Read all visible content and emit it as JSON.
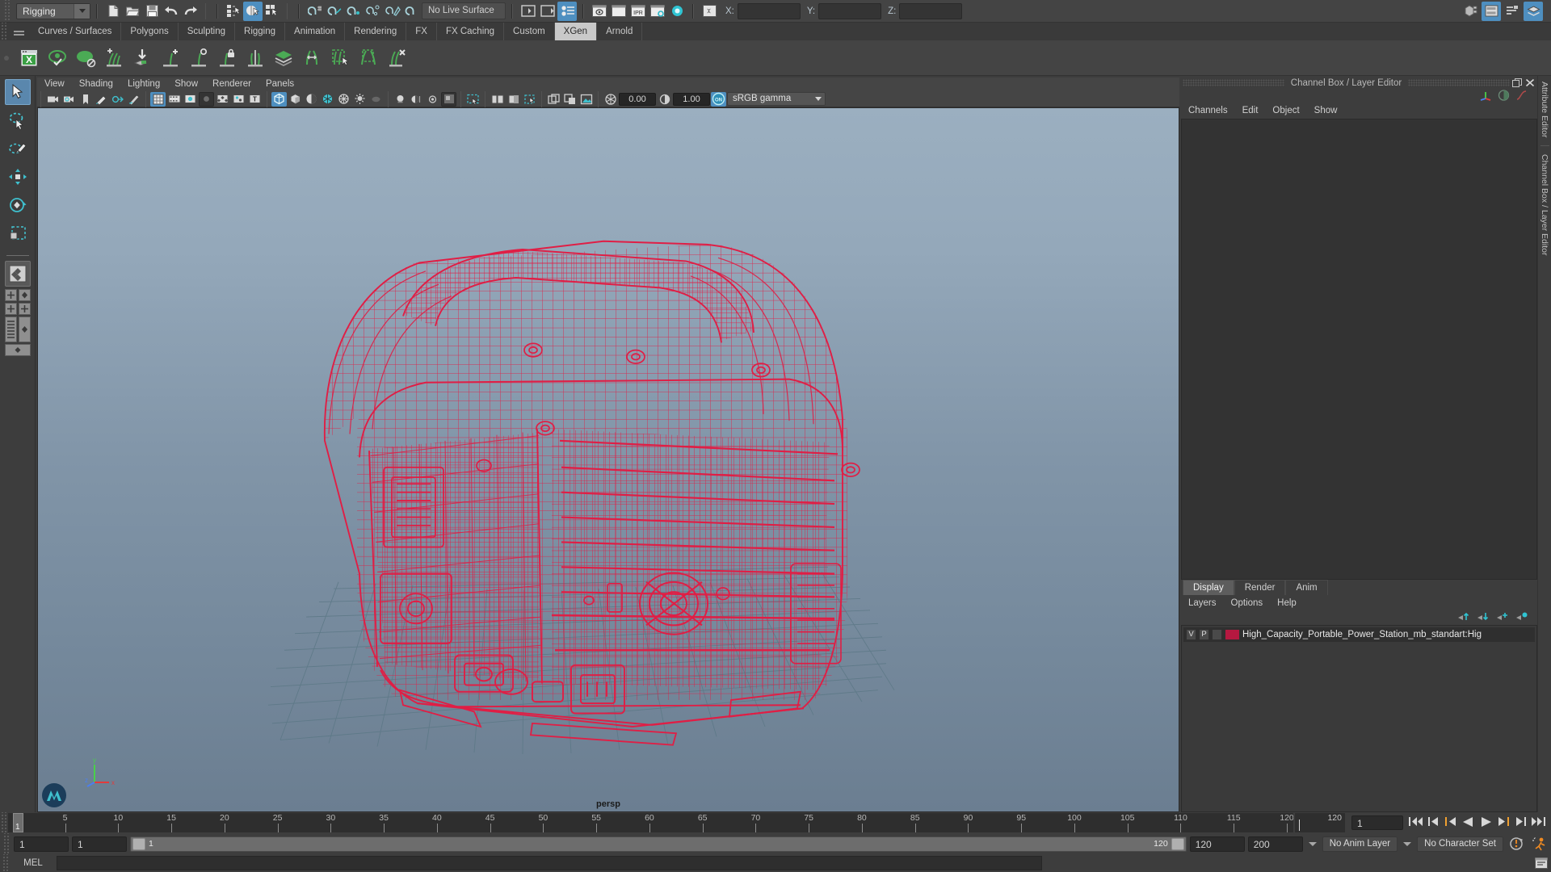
{
  "status_line": {
    "menu_set": "Rigging",
    "live_surface": "No Live Surface",
    "coord_labels": {
      "x": "X:",
      "y": "Y:",
      "z": "Z:"
    },
    "coord_values": {
      "x": "",
      "y": "",
      "z": ""
    },
    "icons": [
      "new-scene-icon",
      "open-scene-icon",
      "save-scene-icon",
      "undo-icon",
      "redo-icon",
      "select-hierarchy-icon",
      "select-object-icon",
      "select-component-icon",
      "snap-grid-icon",
      "snap-curve-icon",
      "snap-point-icon",
      "snap-projected-center-icon",
      "snap-view-plane-icon",
      "make-live-icon",
      "sidebar-open-icon",
      "sidebar-close-icon",
      "attribute-editor-toggle-icon",
      "render-current-frame-icon",
      "ipr-render-icon",
      "render-settings-icon",
      "hypershade-icon",
      "render-view-icon",
      "toggle-editors-icon"
    ],
    "right_icons": [
      "modeling-toolkit-icon",
      "channel-box-icon",
      "attribute-editor-icon",
      "layer-editor-icon"
    ]
  },
  "shelf_tabs": {
    "items": [
      "Curves / Surfaces",
      "Polygons",
      "Sculpting",
      "Rigging",
      "Animation",
      "Rendering",
      "FX",
      "FX Caching",
      "Custom",
      "XGen",
      "Arnold"
    ],
    "active": "XGen"
  },
  "shelf": {
    "items": [
      {
        "name": "xgen-editor-icon",
        "label": "XGen Editor"
      },
      {
        "name": "xgen-preview-icon",
        "label": "Preview"
      },
      {
        "name": "xgen-guide-icon",
        "label": "Guide"
      },
      {
        "name": "xgen-add-guide-icon",
        "label": "Add Guide"
      },
      {
        "name": "xgen-import-icon",
        "label": "Import"
      },
      {
        "name": "xgen-add-move-icon",
        "label": "Add or Move"
      },
      {
        "name": "xgen-sculpt-icon",
        "label": "Sculpt"
      },
      {
        "name": "xgen-lock-icon",
        "label": "Lock"
      },
      {
        "name": "xgen-part-icon",
        "label": "Part"
      },
      {
        "name": "xgen-layers-icon",
        "label": "Layers"
      },
      {
        "name": "xgen-length-icon",
        "label": "Length"
      },
      {
        "name": "xgen-select-region-icon",
        "label": "Select Region"
      },
      {
        "name": "xgen-clump-icon",
        "label": "Clump"
      },
      {
        "name": "xgen-remove-icon",
        "label": "Remove"
      }
    ]
  },
  "toolbox": {
    "tools": [
      {
        "name": "select-tool",
        "label": "Select Tool",
        "selected": true
      },
      {
        "name": "lasso-select-tool",
        "label": "Lasso Select Tool",
        "selected": false
      },
      {
        "name": "paint-select-tool",
        "label": "Paint Select Tool",
        "selected": false
      },
      {
        "name": "move-tool",
        "label": "Move Tool",
        "selected": false
      },
      {
        "name": "rotate-tool",
        "label": "Rotate Tool",
        "selected": false
      },
      {
        "name": "scale-tool",
        "label": "Scale Tool",
        "selected": false
      }
    ],
    "layout_buttons": [
      {
        "name": "layout-single-perspective",
        "label": "Single Perspective View"
      },
      {
        "name": "layout-four-view",
        "label": "Four View"
      },
      {
        "name": "layout-outliner-persp",
        "label": "Outliner/Persp"
      },
      {
        "name": "layout-hypergraph-persp",
        "label": "Hypergraph/Persp"
      },
      {
        "name": "layout-persp-graph",
        "label": "Persp/Graph Editor"
      }
    ]
  },
  "viewport": {
    "menus": [
      "View",
      "Shading",
      "Lighting",
      "Show",
      "Renderer",
      "Panels"
    ],
    "camera_label": "persp",
    "exposure": "0.00",
    "gamma": "1.00",
    "color_management": "sRGB gamma",
    "toolbar_icons": [
      "select-camera-icon",
      "camera-attributes-icon",
      "bookmark-icon",
      "image-plane-icon",
      "two-sided-lighting-icon",
      "light-shading-icon",
      "grid-toggle-icon",
      "film-gate-icon",
      "resolution-gate-icon",
      "gate-mask-icon",
      "xray-joints-icon",
      "xray-icon",
      "texture-toggle-icon",
      "wireframe-shaded-icon",
      "smooth-shaded-icon",
      "flat-shaded-icon",
      "shaded-wireframe-icon",
      "textured-icon",
      "use-all-lights-icon",
      "shadows-icon",
      "screen-space-ao-icon",
      "motion-blur-icon",
      "multisample-icon",
      "isolate-select-icon",
      "grid-xray-icon",
      "gpu-cache-icon",
      "viewport-snapshot-icon",
      "exposure-icon",
      "gamma-icon",
      "color-management-icon"
    ],
    "grid_color": "#5d7a86",
    "background_top": "#9aadbe",
    "background_bottom": "#6c7f92",
    "wireframe_color": "#e01e45"
  },
  "channel_box": {
    "panel_title": "Channel Box / Layer Editor",
    "menus": [
      "Channels",
      "Edit",
      "Object",
      "Show"
    ],
    "header_icons": [
      "axis-gizmo-icon",
      "sphere-shade-icon",
      "anim-curve-icon"
    ],
    "rows": []
  },
  "layer_editor": {
    "tabs": [
      "Display",
      "Render",
      "Anim"
    ],
    "active_tab": "Display",
    "menus": [
      "Layers",
      "Options",
      "Help"
    ],
    "buttons": [
      "move-layer-up-icon",
      "move-layer-down-icon",
      "new-layer-icon",
      "new-layer-from-selected-icon"
    ],
    "layers": [
      {
        "visibility": "V",
        "playback": "P",
        "state": "",
        "color": "#b51840",
        "name": "High_Capacity_Portable_Power_Station_mb_standart:Hig"
      }
    ]
  },
  "attribute_strip": {
    "tabs": [
      "Attribute Editor",
      "Channel Box / Layer Editor"
    ]
  },
  "timeline": {
    "current_frame": "1",
    "end_display": "120",
    "playback_field": "1",
    "ticks": [
      5,
      10,
      15,
      20,
      25,
      30,
      35,
      40,
      45,
      50,
      55,
      60,
      65,
      70,
      75,
      80,
      85,
      90,
      95,
      100,
      105,
      110,
      115,
      120
    ],
    "range_start": 1,
    "range_end": 120,
    "playback_buttons": [
      "go-to-start-icon",
      "step-back-keyframe-icon",
      "step-back-frame-icon",
      "play-backwards-icon",
      "play-forwards-icon",
      "step-forward-frame-icon",
      "step-forward-keyframe-icon",
      "go-to-end-icon"
    ]
  },
  "range_row": {
    "anim_start": "1",
    "range_start": "1",
    "slider_left_value": "1",
    "slider_right_value": "120",
    "range_end": "120",
    "anim_end": "200",
    "anim_layer": "No Anim Layer",
    "character_set": "No Character Set",
    "right_icons": [
      "auto-keyframe-icon",
      "animation-preferences-icon"
    ]
  },
  "mel_row": {
    "label": "MEL",
    "command": "",
    "output": ""
  }
}
